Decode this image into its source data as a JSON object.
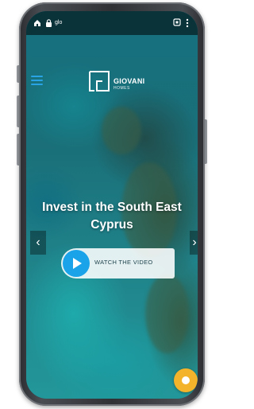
{
  "browser": {
    "url_text": "glo",
    "home_icon": "home-icon",
    "lock_icon": "lock-icon",
    "tabs_icon": "tabs-icon",
    "menu_icon": "more-vert-icon"
  },
  "header": {
    "menu_icon": "hamburger-icon",
    "logo": {
      "name": "GIOVANI",
      "subtitle": "HOMES"
    }
  },
  "hero": {
    "title": "Invest in the South East Cyprus",
    "prev_symbol": "‹",
    "next_symbol": "›",
    "video_button": {
      "label": "WATCH THE VIDEO",
      "icon": "play-icon"
    }
  },
  "chat": {
    "icon": "chat-icon"
  },
  "colors": {
    "accent_blue": "#1aa3e8",
    "chat_yellow": "#f3b32a",
    "sea": "#1d6d7f"
  }
}
